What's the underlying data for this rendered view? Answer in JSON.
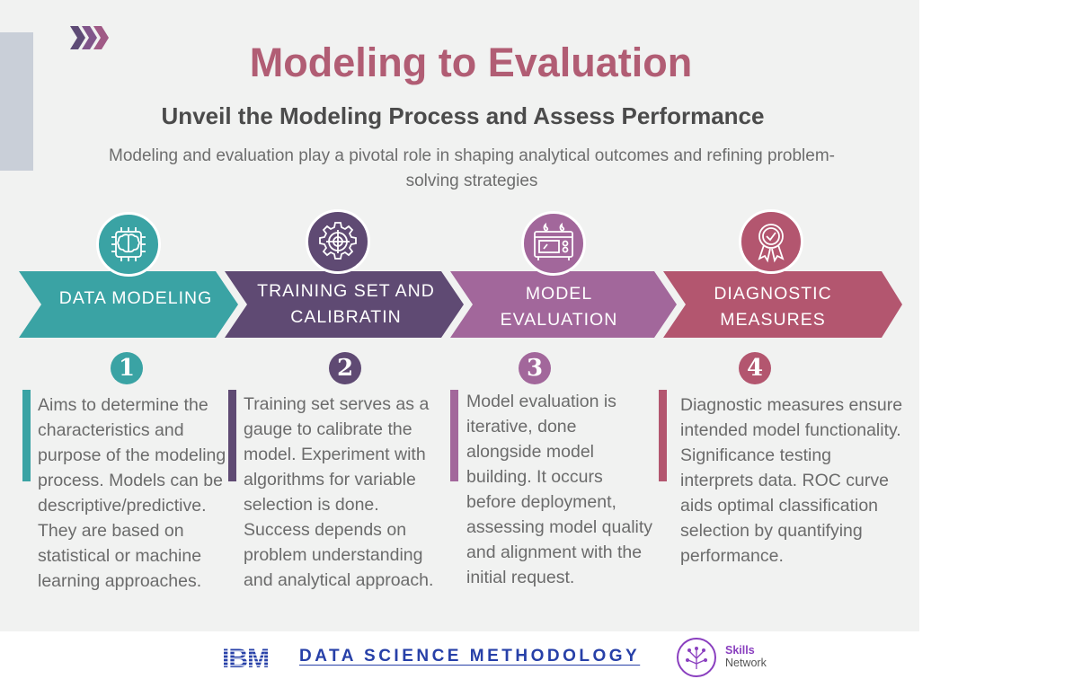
{
  "header": {
    "title": "Modeling to Evaluation",
    "subtitle": "Unveil the Modeling Process and Assess Performance",
    "intro": "Modeling and evaluation play a pivotal role in shaping analytical outcomes and refining problem-solving strategies"
  },
  "stages": [
    {
      "label_line1": "DATA MODELING",
      "label_line2": "",
      "number": "1",
      "icon": "brain-chip-icon",
      "color": "#3aa3a4",
      "description": "Aims to determine the characteristics and purpose of the modeling process. Models can be descriptive/predictive. They are based on statistical or machine learning approaches."
    },
    {
      "label_line1": "TRAINING SET AND",
      "label_line2": "CALIBRATIN",
      "number": "2",
      "icon": "gear-target-icon",
      "color": "#5f4a73",
      "description": "Training set serves as a gauge to calibrate the model. Experiment with algorithms for variable selection is done. Success depends on problem understanding and analytical approach."
    },
    {
      "label_line1": "MODEL",
      "label_line2": "EVALUATION",
      "number": "3",
      "icon": "evaluation-device-icon",
      "color": "#a2679b",
      "description": "Model evaluation is iterative, done alongside model building. It occurs before deployment, assessing model quality and alignment with the initial request."
    },
    {
      "label_line1": "DIAGNOSTIC",
      "label_line2": "MEASURES",
      "number": "4",
      "icon": "award-ribbon-icon",
      "color": "#b3566f",
      "description": "Diagnostic measures ensure intended model functionality. Significance testing interprets data. ROC curve aids optimal classification selection by quantifying performance."
    }
  ],
  "footer": {
    "brand": "IBM",
    "title": "DATA SCIENCE METHODOLOGY",
    "skills_line1": "Skills",
    "skills_line2": "Network"
  },
  "colors": {
    "title": "#b15d74",
    "footer_title": "#2740a8",
    "background": "#f1f2f1",
    "side_bar": "#c9cfd8"
  }
}
